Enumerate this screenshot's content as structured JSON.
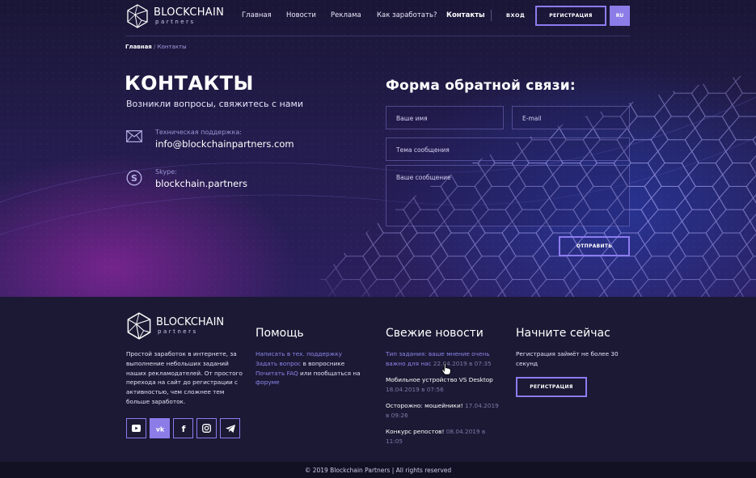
{
  "brand": {
    "name": "BLOCKCHAIN",
    "tagline": "partners"
  },
  "nav": {
    "items": [
      {
        "label": "Главная"
      },
      {
        "label": "Новости"
      },
      {
        "label": "Реклама"
      },
      {
        "label": "Как заработать?"
      },
      {
        "label": "Контакты",
        "active": true
      }
    ],
    "login": "ВХОД",
    "register": "РЕГИСТРАЦИЯ",
    "lang": "RU"
  },
  "breadcrumb": {
    "home": "Главная",
    "separator": "/",
    "current": "Контакты"
  },
  "page": {
    "title": "КОНТАКТЫ",
    "subtitle": "Возникли вопросы, свяжитесь с нами",
    "support_label": "Техническая поддержка:",
    "support_email": "info@blockchainpartners.com",
    "skype_label": "Skype:",
    "skype_value": "blockchain.partners"
  },
  "form": {
    "title": "Форма обратной связи:",
    "name_placeholder": "Ваше имя",
    "email_placeholder": "E-mail",
    "subject_placeholder": "Тема сообщения",
    "message_placeholder": "Ваше сообщение",
    "submit": "ОТПРАВИТЬ"
  },
  "footer": {
    "description": "Простой заработок в интернете, за выполнение небольших заданий наших рекламодателей. От простого перехода на сайт до регистрации с активностью, чем сложнее тем больше заработок.",
    "help": {
      "title": "Помощь",
      "write_support": "Написать в тех. поддержку",
      "ask_question": "Задать вопрос",
      "ask_suffix": " в вопроснике",
      "read_faq": "Почитать FAQ",
      "faq_middle": " или пообщаться на ",
      "forum": "форуме"
    },
    "news": {
      "title": "Свежие новости",
      "items": [
        {
          "title": "Тип задания: ваше мнение очень важно для нас",
          "date": "22.04.2019 в 07:35",
          "link": true
        },
        {
          "title": "Мобильное устройство VS Desktop",
          "date": "18.04.2019 в 07:56",
          "link": false
        },
        {
          "title": "Осторожно: мошейники!",
          "date": "17.04.2019 в 09:26",
          "link": false
        },
        {
          "title": "Конкурс репостов!",
          "date": "08.04.2019 в 11:05",
          "link": false
        }
      ]
    },
    "start": {
      "title": "Начните сейчас",
      "text": "Регистрация займёт не более 30 секунд",
      "register": "РЕГИСТРАЦИЯ"
    },
    "social": [
      "youtube-icon",
      "vk-icon",
      "facebook-icon",
      "instagram-icon",
      "telegram-icon"
    ],
    "copyright": "© 2019 Blockchain Partners   |   All rights reserved"
  },
  "colors": {
    "accent": "#8c7cf0",
    "link": "#8f86ec",
    "footer_bg": "#1b1934"
  }
}
